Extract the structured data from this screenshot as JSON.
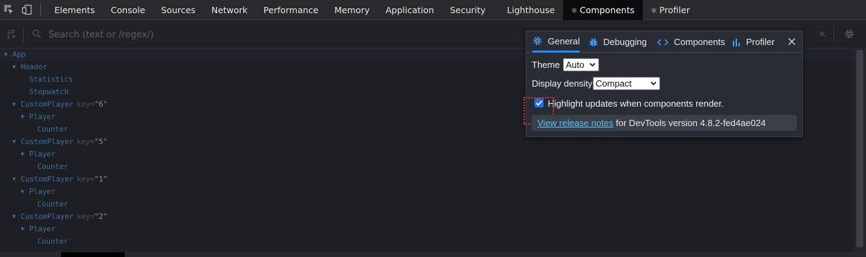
{
  "devtools_tabs": [
    {
      "label": "Elements"
    },
    {
      "label": "Console"
    },
    {
      "label": "Sources"
    },
    {
      "label": "Network"
    },
    {
      "label": "Performance"
    },
    {
      "label": "Memory"
    },
    {
      "label": "Application"
    },
    {
      "label": "Security"
    },
    {
      "label": "Lighthouse"
    },
    {
      "label": "Components",
      "active": true
    },
    {
      "label": "Profiler"
    }
  ],
  "toolbar": {
    "search_placeholder": "Search (text or /regex/)"
  },
  "tree": [
    {
      "depth": 0,
      "expanded": true,
      "name": "App",
      "key": null
    },
    {
      "depth": 1,
      "expanded": true,
      "name": "Header",
      "key": null
    },
    {
      "depth": 2,
      "expanded": false,
      "name": "Statistics",
      "key": null
    },
    {
      "depth": 2,
      "expanded": false,
      "name": "Stopwatch",
      "key": null
    },
    {
      "depth": 1,
      "expanded": true,
      "name": "CustomPlayer",
      "key": "\"6\""
    },
    {
      "depth": 2,
      "expanded": true,
      "name": "Player",
      "key": null
    },
    {
      "depth": 3,
      "expanded": false,
      "name": "Counter",
      "key": null
    },
    {
      "depth": 1,
      "expanded": true,
      "name": "CustomPlayer",
      "key": "\"5\""
    },
    {
      "depth": 2,
      "expanded": true,
      "name": "Player",
      "key": null
    },
    {
      "depth": 3,
      "expanded": false,
      "name": "Counter",
      "key": null
    },
    {
      "depth": 1,
      "expanded": true,
      "name": "CustomPlayer",
      "key": "\"1\""
    },
    {
      "depth": 2,
      "expanded": true,
      "name": "Player",
      "key": null
    },
    {
      "depth": 3,
      "expanded": false,
      "name": "Counter",
      "key": null
    },
    {
      "depth": 1,
      "expanded": true,
      "name": "CustomPlayer",
      "key": "\"2\""
    },
    {
      "depth": 2,
      "expanded": true,
      "name": "Player",
      "key": null
    },
    {
      "depth": 3,
      "expanded": false,
      "name": "Counter",
      "key": null
    }
  ],
  "tree_key_label": "key=",
  "settings": {
    "tabs": [
      {
        "label": "General",
        "icon": "gear-icon",
        "active": true
      },
      {
        "label": "Debugging",
        "icon": "bug-icon"
      },
      {
        "label": "Components",
        "icon": "code-icon"
      },
      {
        "label": "Profiler",
        "icon": "bar-chart-icon"
      }
    ],
    "theme_label": "Theme",
    "theme_value": "Auto",
    "density_label": "Display density",
    "density_value": "Compact",
    "highlight_label": "Highlight updates when components render.",
    "highlight_checked": true,
    "release_link": "View release notes",
    "release_text": " for DevTools version 4.8.2-fed4ae024"
  },
  "colors": {
    "accent": "#1a73e8",
    "link": "#57c3ff",
    "highlight_frame": "#e0342b",
    "tree_name": "#3c6f9c"
  }
}
